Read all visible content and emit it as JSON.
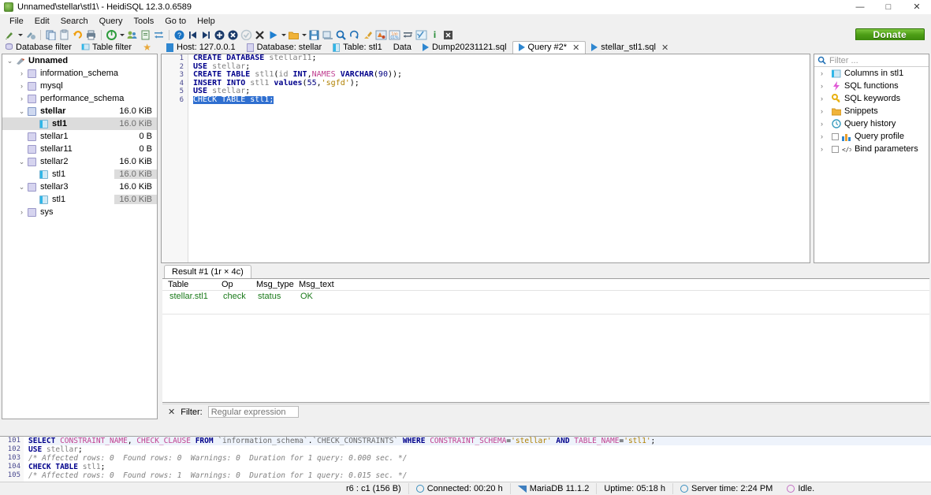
{
  "window": {
    "title": "Unnamed\\stellar\\stl1\\ - HeidiSQL 12.3.0.6589",
    "minimize": "—",
    "maximize": "□",
    "close": "✕"
  },
  "menubar": {
    "items": [
      "File",
      "Edit",
      "Search",
      "Query",
      "Tools",
      "Go to",
      "Help"
    ]
  },
  "toolbar": {
    "donate_label": "Donate"
  },
  "left_filters": {
    "database_filter": "Database filter",
    "table_filter": "Table filter",
    "star": "★"
  },
  "tree": {
    "rows": [
      {
        "label": "Unnamed",
        "size": "",
        "indent": 0,
        "expander": "⌄",
        "icon": "connection-icon",
        "bold": true,
        "selected": false,
        "size_gray": false
      },
      {
        "label": "information_schema",
        "size": "",
        "indent": 1,
        "expander": "›",
        "icon": "database-icon",
        "bold": false,
        "selected": false,
        "size_gray": false
      },
      {
        "label": "mysql",
        "size": "",
        "indent": 1,
        "expander": "›",
        "icon": "database-icon",
        "bold": false,
        "selected": false,
        "size_gray": false
      },
      {
        "label": "performance_schema",
        "size": "",
        "indent": 1,
        "expander": "›",
        "icon": "database-icon",
        "bold": false,
        "selected": false,
        "size_gray": false
      },
      {
        "label": "stellar",
        "size": "16.0 KiB",
        "indent": 1,
        "expander": "⌄",
        "icon": "database-icon",
        "bold": true,
        "selected": false,
        "size_gray": false
      },
      {
        "label": "stl1",
        "size": "16.0 KiB",
        "indent": 2,
        "expander": "",
        "icon": "table-icon",
        "bold": true,
        "selected": true,
        "size_gray": true
      },
      {
        "label": "stellar1",
        "size": "0 B",
        "indent": 1,
        "expander": "",
        "icon": "database-icon",
        "bold": false,
        "selected": false,
        "size_gray": false
      },
      {
        "label": "stellar11",
        "size": "0 B",
        "indent": 1,
        "expander": "",
        "icon": "database-icon",
        "bold": false,
        "selected": false,
        "size_gray": false
      },
      {
        "label": "stellar2",
        "size": "16.0 KiB",
        "indent": 1,
        "expander": "⌄",
        "icon": "database-icon",
        "bold": false,
        "selected": false,
        "size_gray": false
      },
      {
        "label": "stl1",
        "size": "16.0 KiB",
        "indent": 2,
        "expander": "",
        "icon": "table-icon",
        "bold": false,
        "selected": false,
        "size_gray": true
      },
      {
        "label": "stellar3",
        "size": "16.0 KiB",
        "indent": 1,
        "expander": "⌄",
        "icon": "database-icon",
        "bold": false,
        "selected": false,
        "size_gray": false
      },
      {
        "label": "stl1",
        "size": "16.0 KiB",
        "indent": 2,
        "expander": "",
        "icon": "table-icon",
        "bold": false,
        "selected": false,
        "size_gray": true
      },
      {
        "label": "sys",
        "size": "",
        "indent": 1,
        "expander": "›",
        "icon": "database-icon",
        "bold": false,
        "selected": false,
        "size_gray": false
      }
    ]
  },
  "tabs": [
    {
      "label": "Host: 127.0.0.1",
      "icon": "host-icon",
      "active": false,
      "closable": false
    },
    {
      "label": "Database: stellar",
      "icon": "database-icon",
      "active": false,
      "closable": false
    },
    {
      "label": "Table: stl1",
      "icon": "table-icon",
      "active": false,
      "closable": false
    },
    {
      "label": "Data",
      "icon": "grid-icon",
      "active": false,
      "closable": false
    },
    {
      "label": "Dump20231121.sql",
      "icon": "query-icon",
      "active": false,
      "closable": false
    },
    {
      "label": "Query #2*",
      "icon": "query-icon",
      "active": true,
      "closable": true
    },
    {
      "label": "stellar_stl1.sql",
      "icon": "query-icon",
      "active": false,
      "closable": true
    }
  ],
  "tab_close_glyph": "✕",
  "editor": {
    "line_numbers": [
      "1",
      "2",
      "3",
      "4",
      "5",
      "6"
    ],
    "lines": [
      "CREATE DATABASE stellar11;",
      "USE stellar;",
      "CREATE TABLE stl1(id INT,NAMES VARCHAR(90));",
      "INSERT INTO stl1 values(55,'sgfd');",
      "USE stellar;",
      "CHECK TABLE stl1;"
    ],
    "selected_line_index": 5
  },
  "helper_panel": {
    "filter_placeholder": "Filter ...",
    "items": [
      {
        "label": "Columns in stl1",
        "icon": "columns-icon",
        "expander": "›",
        "checkbox": false
      },
      {
        "label": "SQL functions",
        "icon": "function-icon",
        "expander": "›",
        "checkbox": false
      },
      {
        "label": "SQL keywords",
        "icon": "key-icon",
        "expander": "›",
        "checkbox": false
      },
      {
        "label": "Snippets",
        "icon": "folder-icon",
        "expander": "›",
        "checkbox": false
      },
      {
        "label": "Query history",
        "icon": "clock-icon",
        "expander": "›",
        "checkbox": false
      },
      {
        "label": "Query profile",
        "icon": "chart-icon",
        "expander": "›",
        "checkbox": true
      },
      {
        "label": "Bind parameters",
        "icon": "code-icon",
        "expander": "›",
        "checkbox": true
      }
    ]
  },
  "results": {
    "tab_label": "Result #1 (1r × 4c)",
    "columns": [
      "Table",
      "Op",
      "Msg_type",
      "Msg_text"
    ],
    "rows": [
      [
        "stellar.stl1",
        "check",
        "status",
        "OK"
      ]
    ]
  },
  "filter_bar": {
    "close_glyph": "✕",
    "label": "Filter:",
    "placeholder": "Regular expression",
    "value": ""
  },
  "log": {
    "line_numbers": [
      "101",
      "102",
      "103",
      "104",
      "105"
    ],
    "lines": [
      "SELECT CONSTRAINT_NAME, CHECK_CLAUSE FROM `information_schema`.`CHECK_CONSTRAINTS` WHERE CONSTRAINT_SCHEMA='stellar' AND TABLE_NAME='stl1';",
      "USE stellar;",
      "/* Affected rows: 0  Found rows: 0  Warnings: 0  Duration for 1 query: 0.000 sec. */",
      "CHECK TABLE stl1;",
      "/* Affected rows: 0  Found rows: 1  Warnings: 0  Duration for 1 query: 0.015 sec. */"
    ]
  },
  "statusbar": {
    "cursor": "r6 : c1 (156 B)",
    "connected": "Connected: 00:20 h",
    "server": "MariaDB 11.1.2",
    "uptime": "Uptime: 05:18 h",
    "server_time": "Server time: 2:24 PM",
    "state": "Idle."
  }
}
